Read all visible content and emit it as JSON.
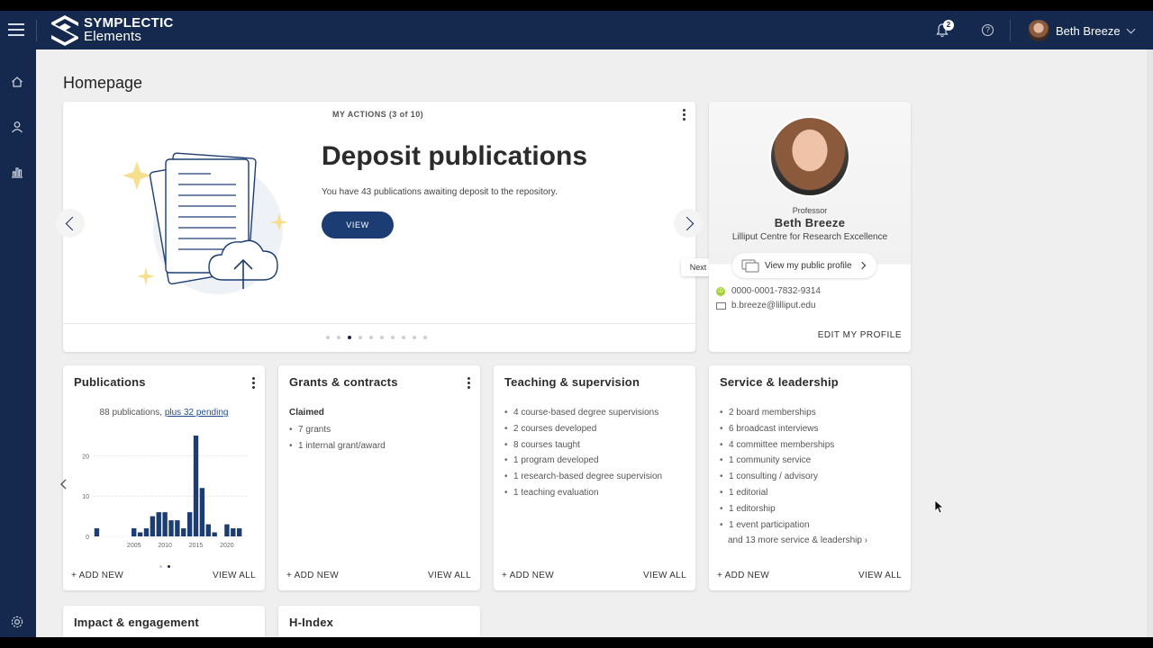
{
  "app": {
    "brand_line1": "SYMPLECTIC",
    "brand_line2": "Elements",
    "notification_count": "2",
    "help_label": "?",
    "user_name": "Beth Breeze"
  },
  "page_title": "Homepage",
  "actions": {
    "caption": "MY ACTIONS (3 of 10)",
    "title": "Deposit publications",
    "description": "You have 43 publications awaiting deposit to the repository.",
    "button": "VIEW",
    "next_tooltip": "Next",
    "dot_count": 10,
    "active_dot": 3
  },
  "profile": {
    "role": "Professor",
    "name": "Beth Breeze",
    "org": "Lilliput Centre for Research Excellence",
    "public_profile": "View my public profile",
    "orcid": "0000-0001-7832-9314",
    "email": "b.breeze@lilliput.edu",
    "edit": "EDIT MY PROFILE"
  },
  "tiles": {
    "add_new": "+ ADD NEW",
    "view_all": "VIEW ALL",
    "publications": {
      "title": "Publications",
      "count_text": "88 publications,",
      "pending_text": "plus 32 pending"
    },
    "grants": {
      "title": "Grants & contracts",
      "subheading": "Claimed",
      "items": [
        "7 grants",
        "1 internal grant/award"
      ]
    },
    "teaching": {
      "title": "Teaching & supervision",
      "items": [
        "4 course-based degree supervisions",
        "2 courses developed",
        "8 courses taught",
        "1 program developed",
        "1 research-based degree supervision",
        "1 teaching evaluation"
      ]
    },
    "service": {
      "title": "Service & leadership",
      "items": [
        "2 board memberships",
        "6 broadcast interviews",
        "4 committee memberships",
        "1 community service",
        "1 consulting / advisory",
        "1 editorial",
        "1 editorship",
        "1 event participation"
      ],
      "more": "and 13 more service & leadership ›"
    },
    "impact": {
      "title": "Impact & engagement"
    },
    "hindex": {
      "title": "H-Index"
    }
  },
  "chart_data": {
    "type": "bar",
    "title": "",
    "xlabel": "",
    "ylabel": "",
    "x_tick_labels": [
      "2005",
      "2010",
      "2015",
      "2020"
    ],
    "y_tick_labels": [
      "0",
      "10",
      "20"
    ],
    "ylim": [
      0,
      25
    ],
    "x": [
      1999,
      2000,
      2001,
      2002,
      2003,
      2004,
      2005,
      2006,
      2007,
      2008,
      2009,
      2010,
      2011,
      2012,
      2013,
      2014,
      2015,
      2016,
      2017,
      2018,
      2019,
      2020,
      2021,
      2022,
      2023
    ],
    "values": [
      2,
      0,
      0,
      0,
      0,
      0,
      2,
      1,
      2,
      5,
      6,
      6,
      4,
      4,
      2,
      6,
      25,
      12,
      3,
      1,
      0,
      3,
      2,
      2,
      0
    ],
    "grid": true,
    "color": "#1c3d73"
  }
}
